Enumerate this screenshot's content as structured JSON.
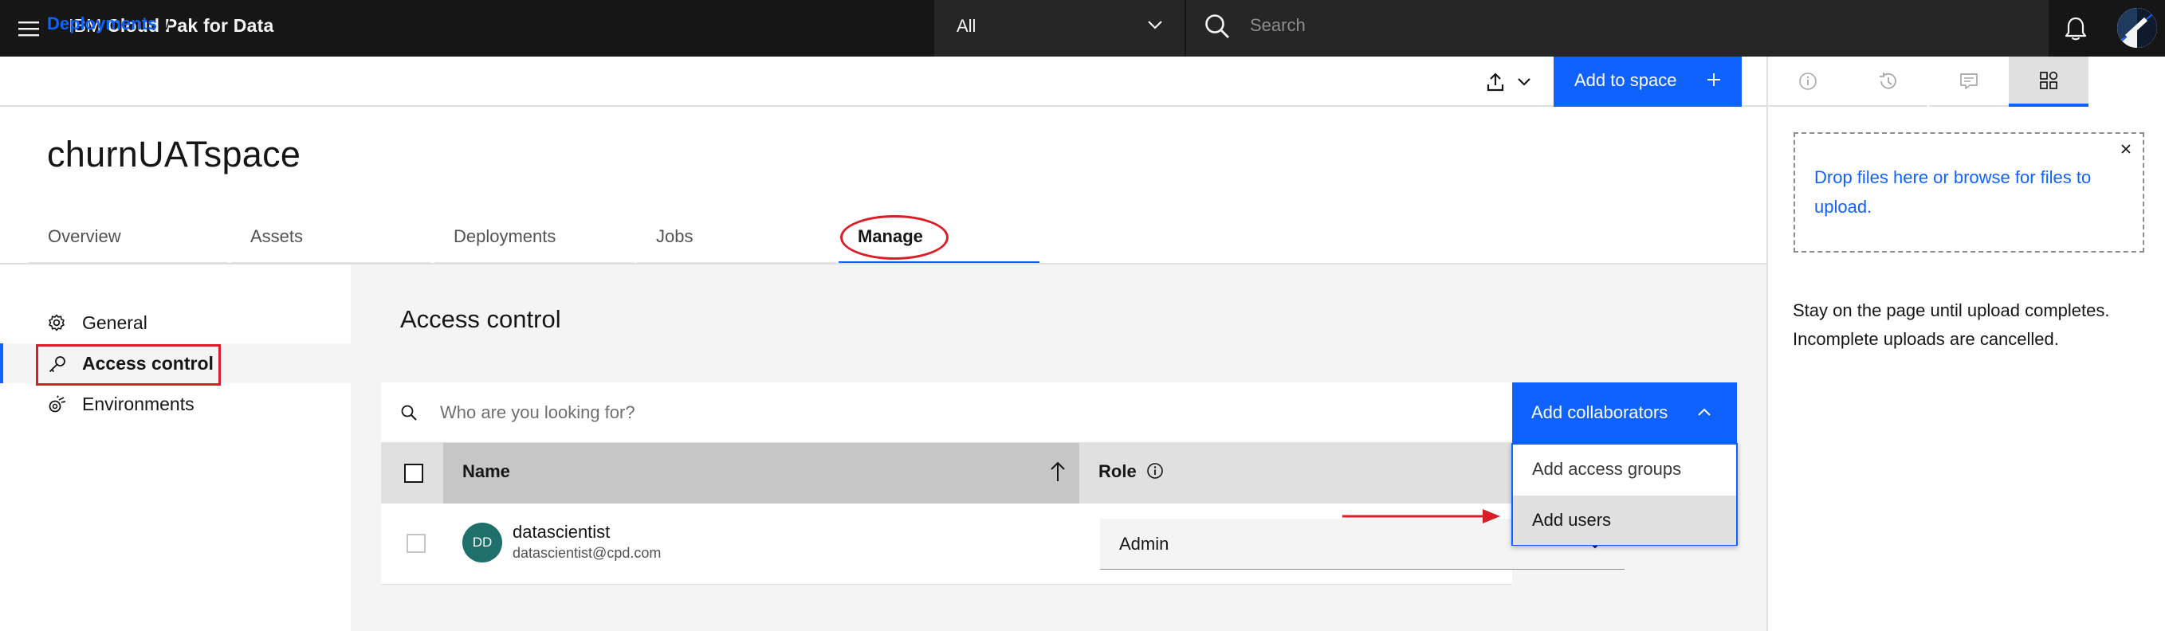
{
  "header": {
    "brand_prefix": "IBM",
    "brand_product": "Cloud Pak for Data",
    "scope_value": "All",
    "search_placeholder": "Search"
  },
  "breadcrumb": {
    "link": "Deployments",
    "separator": "/"
  },
  "toolbar": {
    "add_to_space_label": "Add to space"
  },
  "page": {
    "title": "churnUATspace",
    "tabs": [
      {
        "label": "Overview"
      },
      {
        "label": "Assets"
      },
      {
        "label": "Deployments"
      },
      {
        "label": "Jobs"
      },
      {
        "label": "Manage",
        "active": true
      }
    ]
  },
  "leftnav": {
    "items": [
      {
        "label": "General",
        "icon": "gear-icon"
      },
      {
        "label": "Access control",
        "icon": "key-icon",
        "active": true
      },
      {
        "label": "Environments",
        "icon": "environment-icon"
      }
    ]
  },
  "access_control": {
    "title": "Access control",
    "search_placeholder": "Who are you looking for?",
    "add_collaborators_label": "Add collaborators",
    "menu": {
      "items": [
        {
          "label": "Add access groups"
        },
        {
          "label": "Add users",
          "highlighted": true
        }
      ]
    },
    "table": {
      "columns": {
        "name": "Name",
        "role": "Role"
      },
      "rows": [
        {
          "initials": "DD",
          "name": "datascientist",
          "email": "datascientist@cpd.com",
          "role": "Admin"
        }
      ]
    }
  },
  "right_panel": {
    "tabs": [
      "info-icon",
      "history-icon",
      "comment-icon",
      "asset-upload-icon"
    ],
    "dropzone_text": "Drop files here or browse for files to upload.",
    "note": "Stay on the page until upload completes. Incomplete uploads are cancelled."
  },
  "colors": {
    "primary": "#0f62fe",
    "header_bg": "#161616",
    "annotation": "#da1e28",
    "avatar": "#1f6f6a"
  }
}
